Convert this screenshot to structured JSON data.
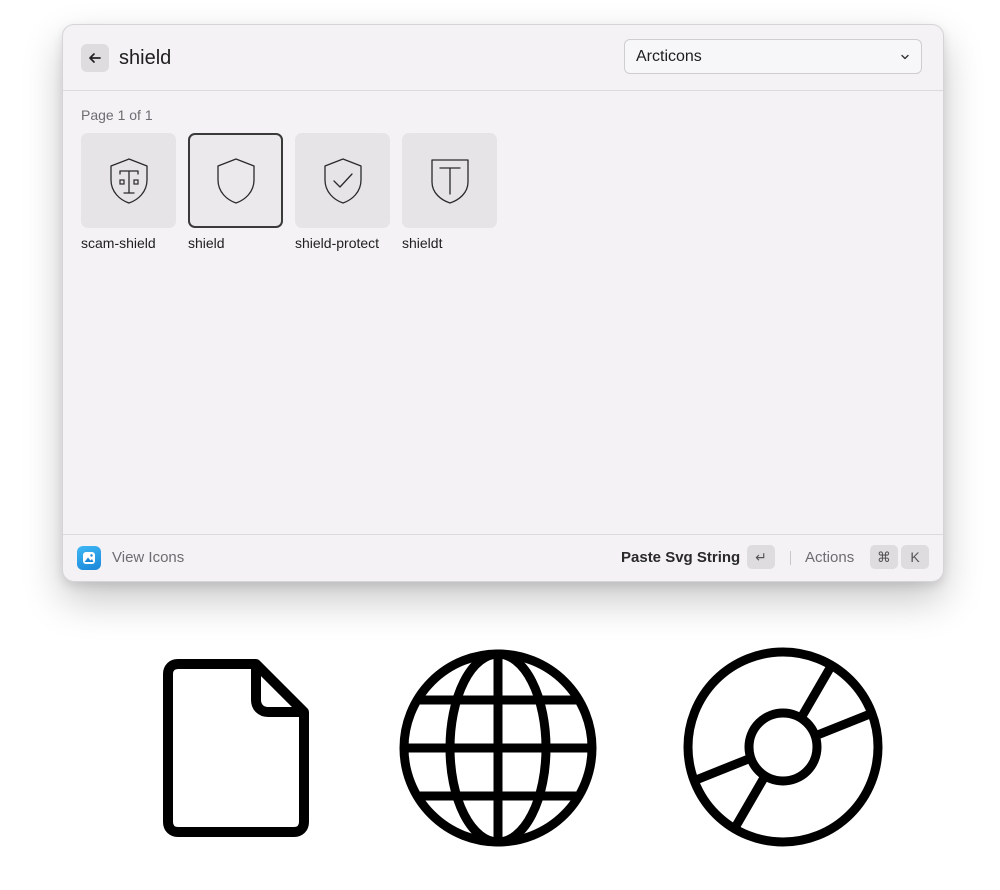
{
  "search": {
    "value": "shield"
  },
  "dropdown": {
    "selected": "Arcticons"
  },
  "page_label": "Page 1 of 1",
  "icons": [
    {
      "label": "scam-shield",
      "icon": "scam-shield-icon",
      "selected": false
    },
    {
      "label": "shield",
      "icon": "shield-icon",
      "selected": true
    },
    {
      "label": "shield-protect",
      "icon": "shield-check-icon",
      "selected": false
    },
    {
      "label": "shieldt",
      "icon": "shield-t-icon",
      "selected": false
    }
  ],
  "footer": {
    "title": "View Icons",
    "primary_action": "Paste Svg String",
    "enter_key": "↵",
    "actions_label": "Actions",
    "cmd_key": "⌘",
    "k_key": "K"
  },
  "showcase_icons": [
    "document-icon",
    "globe-icon",
    "disc-icon"
  ],
  "colors": {
    "window_bg": "#f4f2f5",
    "tile_bg": "#e6e4e7",
    "app_icon": "#1a86d8"
  }
}
